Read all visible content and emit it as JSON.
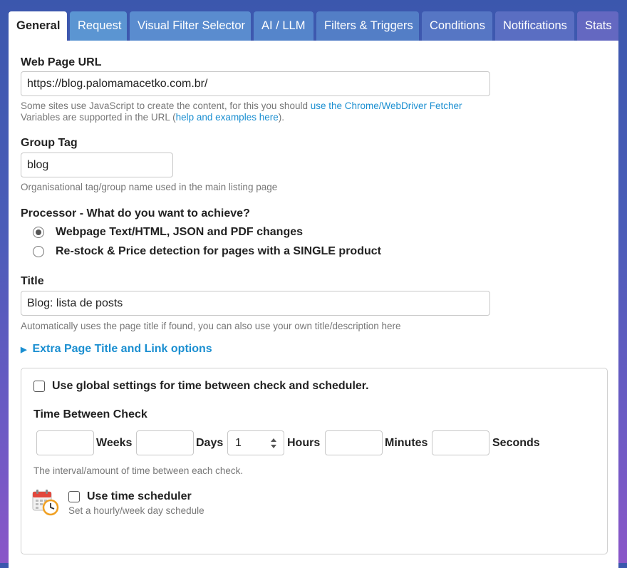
{
  "tabs": [
    {
      "label": "General",
      "active": true
    },
    {
      "label": "Request"
    },
    {
      "label": "Visual Filter Selector"
    },
    {
      "label": "AI / LLM"
    },
    {
      "label": "Filters & Triggers"
    },
    {
      "label": "Conditions"
    },
    {
      "label": "Notifications"
    },
    {
      "label": "Stats"
    }
  ],
  "url": {
    "label": "Web Page URL",
    "value": "https://blog.palomamacetko.com.br/",
    "help_prefix": "Some sites use JavaScript to create the content, for this you should ",
    "help_link": "use the Chrome/WebDriver Fetcher",
    "help_line2_prefix": "Variables are supported in the URL (",
    "help_line2_link": "help and examples here",
    "help_line2_suffix": ")."
  },
  "group_tag": {
    "label": "Group Tag",
    "value": "blog",
    "help": "Organisational tag/group name used in the main listing page"
  },
  "processor": {
    "label": "Processor - What do you want to achieve?",
    "options": [
      {
        "label": "Webpage Text/HTML, JSON and PDF changes",
        "checked": true
      },
      {
        "label": "Re-stock & Price detection for pages with a SINGLE product",
        "checked": false
      }
    ]
  },
  "title": {
    "label": "Title",
    "value": "Blog: lista de posts",
    "help": "Automatically uses the page title if found, you can also use your own title/description here"
  },
  "extra_options": {
    "label": "Extra Page Title and Link options"
  },
  "schedule": {
    "use_global": {
      "label": "Use global settings for time between check and scheduler.",
      "checked": false
    },
    "time_between_label": "Time Between Check",
    "fields": [
      {
        "unit": "Weeks",
        "value": ""
      },
      {
        "unit": "Days",
        "value": ""
      },
      {
        "unit": "Hours",
        "value": "1"
      },
      {
        "unit": "Minutes",
        "value": ""
      },
      {
        "unit": "Seconds",
        "value": ""
      }
    ],
    "interval_help": "The interval/amount of time between each check.",
    "scheduler": {
      "label": "Use time scheduler",
      "help": "Set a hourly/week day schedule",
      "checked": false
    }
  },
  "colors": {
    "link": "#1b8fd1",
    "tab_bg": "#5b8fd0"
  }
}
